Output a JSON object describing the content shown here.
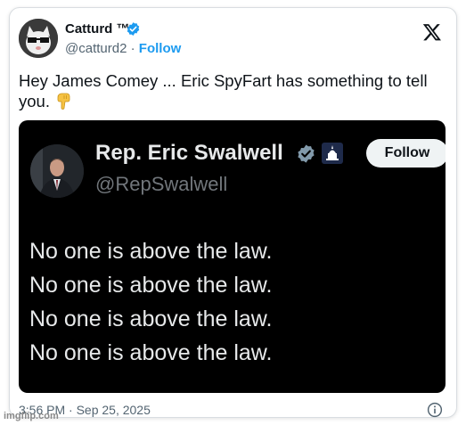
{
  "author": {
    "name": "Catturd ™",
    "handle": "@catturd2",
    "separator": " · ",
    "follow_label": "Follow",
    "verified_color": "#1d9bf0"
  },
  "tweet": {
    "text": "Hey James Comey ... Eric SpyFart has something to tell you.",
    "emoji": "hand-pointing-down-icon"
  },
  "embedded": {
    "name": "Rep. Eric Swalwell",
    "handle": "@RepSwalwell",
    "follow_label": "Follow",
    "lines": [
      "No one is above the law.",
      "No one is above the law.",
      "No one is above the law.",
      "No one is above the law."
    ]
  },
  "footer": {
    "timestamp": "3:56 PM · Sep 25, 2025"
  },
  "watermark": "imgflip.com"
}
